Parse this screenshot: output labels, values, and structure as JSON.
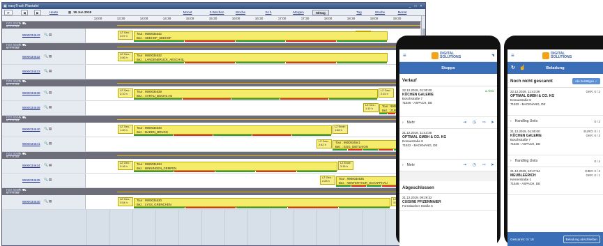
{
  "window": {
    "title": "easyTrack Plantafel",
    "controls": [
      "_",
      "□",
      "×"
    ],
    "toolbar": {
      "heute": "Heute",
      "date": "18 Jun 2018",
      "monat": "Monat",
      "zwei_wochen": "2-Wochen",
      "woche": "Woche",
      "h24": "24 h",
      "morgen": "Morgen",
      "mittag": "Mittag",
      "tag": "Tag",
      "woche2": "Woche",
      "monat2": "Monat"
    },
    "hours": [
      "13:00",
      "13:30",
      "14:00",
      "14:30",
      "15:00",
      "15:30",
      "16:00",
      "16:30",
      "17:00",
      "17:30",
      "18:00",
      "18:30",
      "19:00",
      "19:30"
    ]
  },
  "schedule": [
    {
      "vehicle": "FZG 0001",
      "sub": "M. F. H. 001"
    },
    {
      "tour_id": "9900034642",
      "labels": [
        {
          "text": "LZ Geo.: 4:07 h"
        },
        {
          "text": "LZ Ende: 4:07 h"
        }
      ],
      "tour": "Tour :  9900034642",
      "bez": "Bez. :  SEEHOF_SEEHOF"
    },
    {
      "vehicle": "FZG 0002",
      "sub": "M. F. H. 002"
    },
    {
      "tour_id": "9900034632",
      "labels": [
        {
          "text": "LZ Geo.: 3:06 h"
        }
      ],
      "tour": "Tour :  9900034632",
      "bez": "Bez. :  LANGENBRUCK_AESCH BL"
    },
    {
      "tour_id": "9900034633",
      "labels": [],
      "tour": "",
      "bez": ""
    },
    {
      "vehicle": "FZG 0003",
      "sub": "M. F. H. 003"
    },
    {
      "tour_id": "9900034638",
      "labels": [
        {
          "text": "LZ Geo.: 2:10 h"
        },
        {
          "text": "LZ Geo.: 2:15 h"
        }
      ],
      "tour": "Tour :  9900034638",
      "bez": "Bez. :  AARAU_BUCHS AG"
    },
    {
      "tour_id": "9900034639",
      "labels": [
        {
          "text": "LZ Geo.: 1:12 h"
        }
      ],
      "tour": "Tour :  990003",
      "bez": "Bez. :  ZUE"
    },
    {
      "vehicle": "FZG 0004",
      "sub": "M. F. H. 004"
    },
    {
      "tour_id": "9900034640",
      "labels": [
        {
          "text": "LZ Geo.: 1:40 h"
        },
        {
          "text": "LZ Ende: 1:48 h"
        }
      ],
      "tour": "Tour :  9900034640",
      "bez": "Bez. :  BADEN_BRUGG"
    },
    {
      "tour_id": "9900034641",
      "labels": [
        {
          "text": "LZ Geo.: 2:42 h"
        }
      ],
      "tour": "Tour :  9900034641",
      "bez": "Bez. :  EGG_DIETLIKON"
    },
    {
      "vehicle": "FZG 0005",
      "sub": "M. F. H. 005"
    },
    {
      "tour_id": "9900034634",
      "labels": [
        {
          "text": "LZ Geo.: 3:16 h"
        },
        {
          "text": "LZ Ende: 3:16 h"
        }
      ],
      "tour": "Tour :  9900034634",
      "bez": "Bez. :  BINNINGEN_GEMPEN"
    },
    {
      "tour_id": "9900034635",
      "labels": [
        {
          "text": "LZ Geo.: 2:28 h"
        }
      ],
      "tour": "Tour :  9900034635",
      "bez": "Bez. :  WINTERTHUR_SCHAPPHAU"
    },
    {
      "vehicle": "FZG 0006",
      "sub": "M. F. H. 006"
    },
    {
      "tour_id": "9900034630",
      "labels": [
        {
          "text": "LZ Geo.: 3:54 h"
        },
        {
          "text": "LZ Geo.: 3:54 h"
        }
      ],
      "tour": "Tour :  9900034630",
      "bez": "Bez. :  LYSS_GRENCHEN"
    }
  ],
  "phone1": {
    "logo_line1": "DIGITAL",
    "logo_line2": "SOLUTIONS",
    "header": "Stopps",
    "section1": "Verlauf",
    "stop1": {
      "date": "22.12.2019, 01:00:00",
      "name": "KÜCHEN GALERIE",
      "street": "Boschstraße 7",
      "city": "71546 - ASPACH, DE",
      "status": "Aktiv"
    },
    "mehr1": "Mehr",
    "stop2": {
      "date": "21.12.2019, 11:43:36",
      "name": "OPTIMAL GMBH & CO. KG",
      "street": "Donaustraße 8",
      "city": "71522 - BACKNANG, DE"
    },
    "mehr2": "Mehr",
    "section2": "Abgeschlossen",
    "stop3": {
      "date": "21.12.2019, 09:29:32",
      "name": "CUISINE PFIZENMAIER",
      "street": "Fornsbacher Straße 6"
    }
  },
  "phone2": {
    "logo_line1": "DIGITAL",
    "logo_line2": "SOLUTIONS",
    "header": "Beladung",
    "section1": "Noch nicht gescannt",
    "confirm_all": "Alle bestätigen",
    "item1": {
      "date": "22.12.2019, 11:43:36",
      "name": "OPTIMAL GMBH & CO. KG",
      "street": "Donaustraße 8",
      "city": "71522 - BACKNANG, DE",
      "count": "GKR: 0 / 2"
    },
    "handling1": "Handling Units",
    "handling1_count": "0 / 2",
    "item2": {
      "date": "21.12.2019, 01:00:00",
      "name": "KÜCHEN GALERIE",
      "street": "Boschstraße 7",
      "city": "71546 - ASPACH, DE",
      "count1": "EURO: 0 / 1",
      "count2": "GKR: 0 / 3"
    },
    "handling2": "Handling Units",
    "handling2_count": "0 / 4",
    "item3": {
      "date": "21.12.2019, 10:47:54",
      "name": "MEUBLEERICH",
      "street": "Kernerstraße 1",
      "city": "71546 - ASPACH, DE",
      "count1": "GIBO: 0 / 2",
      "count2": "GKR: 0 / 1"
    },
    "footer_count": "Gescannt: 0 / 18",
    "footer_button": "Beladung abschließen"
  }
}
